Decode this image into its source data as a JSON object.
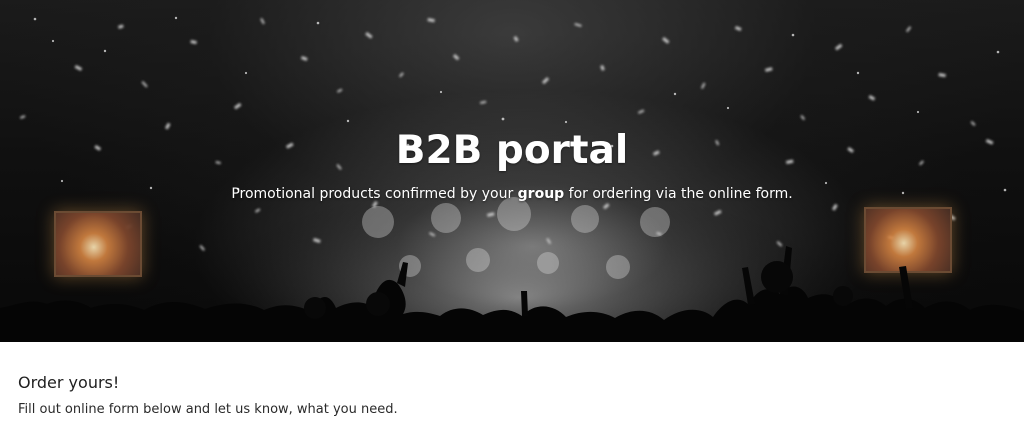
{
  "hero": {
    "title": "B2B portal",
    "subtitle_before": "Promotional products confirmed by your ",
    "subtitle_emphasis": "group",
    "subtitle_after": " for ordering via the online form."
  },
  "order_section": {
    "heading": "Order yours!",
    "description": "Fill out online form below and let us know, what you need."
  },
  "colors": {
    "hero_text": "#ffffff",
    "page_background": "#ffffff",
    "heading_text": "#1f1f1f",
    "body_text": "#2a2a2a"
  },
  "icons": {
    "hero_image": "concert-crowd-confetti"
  }
}
